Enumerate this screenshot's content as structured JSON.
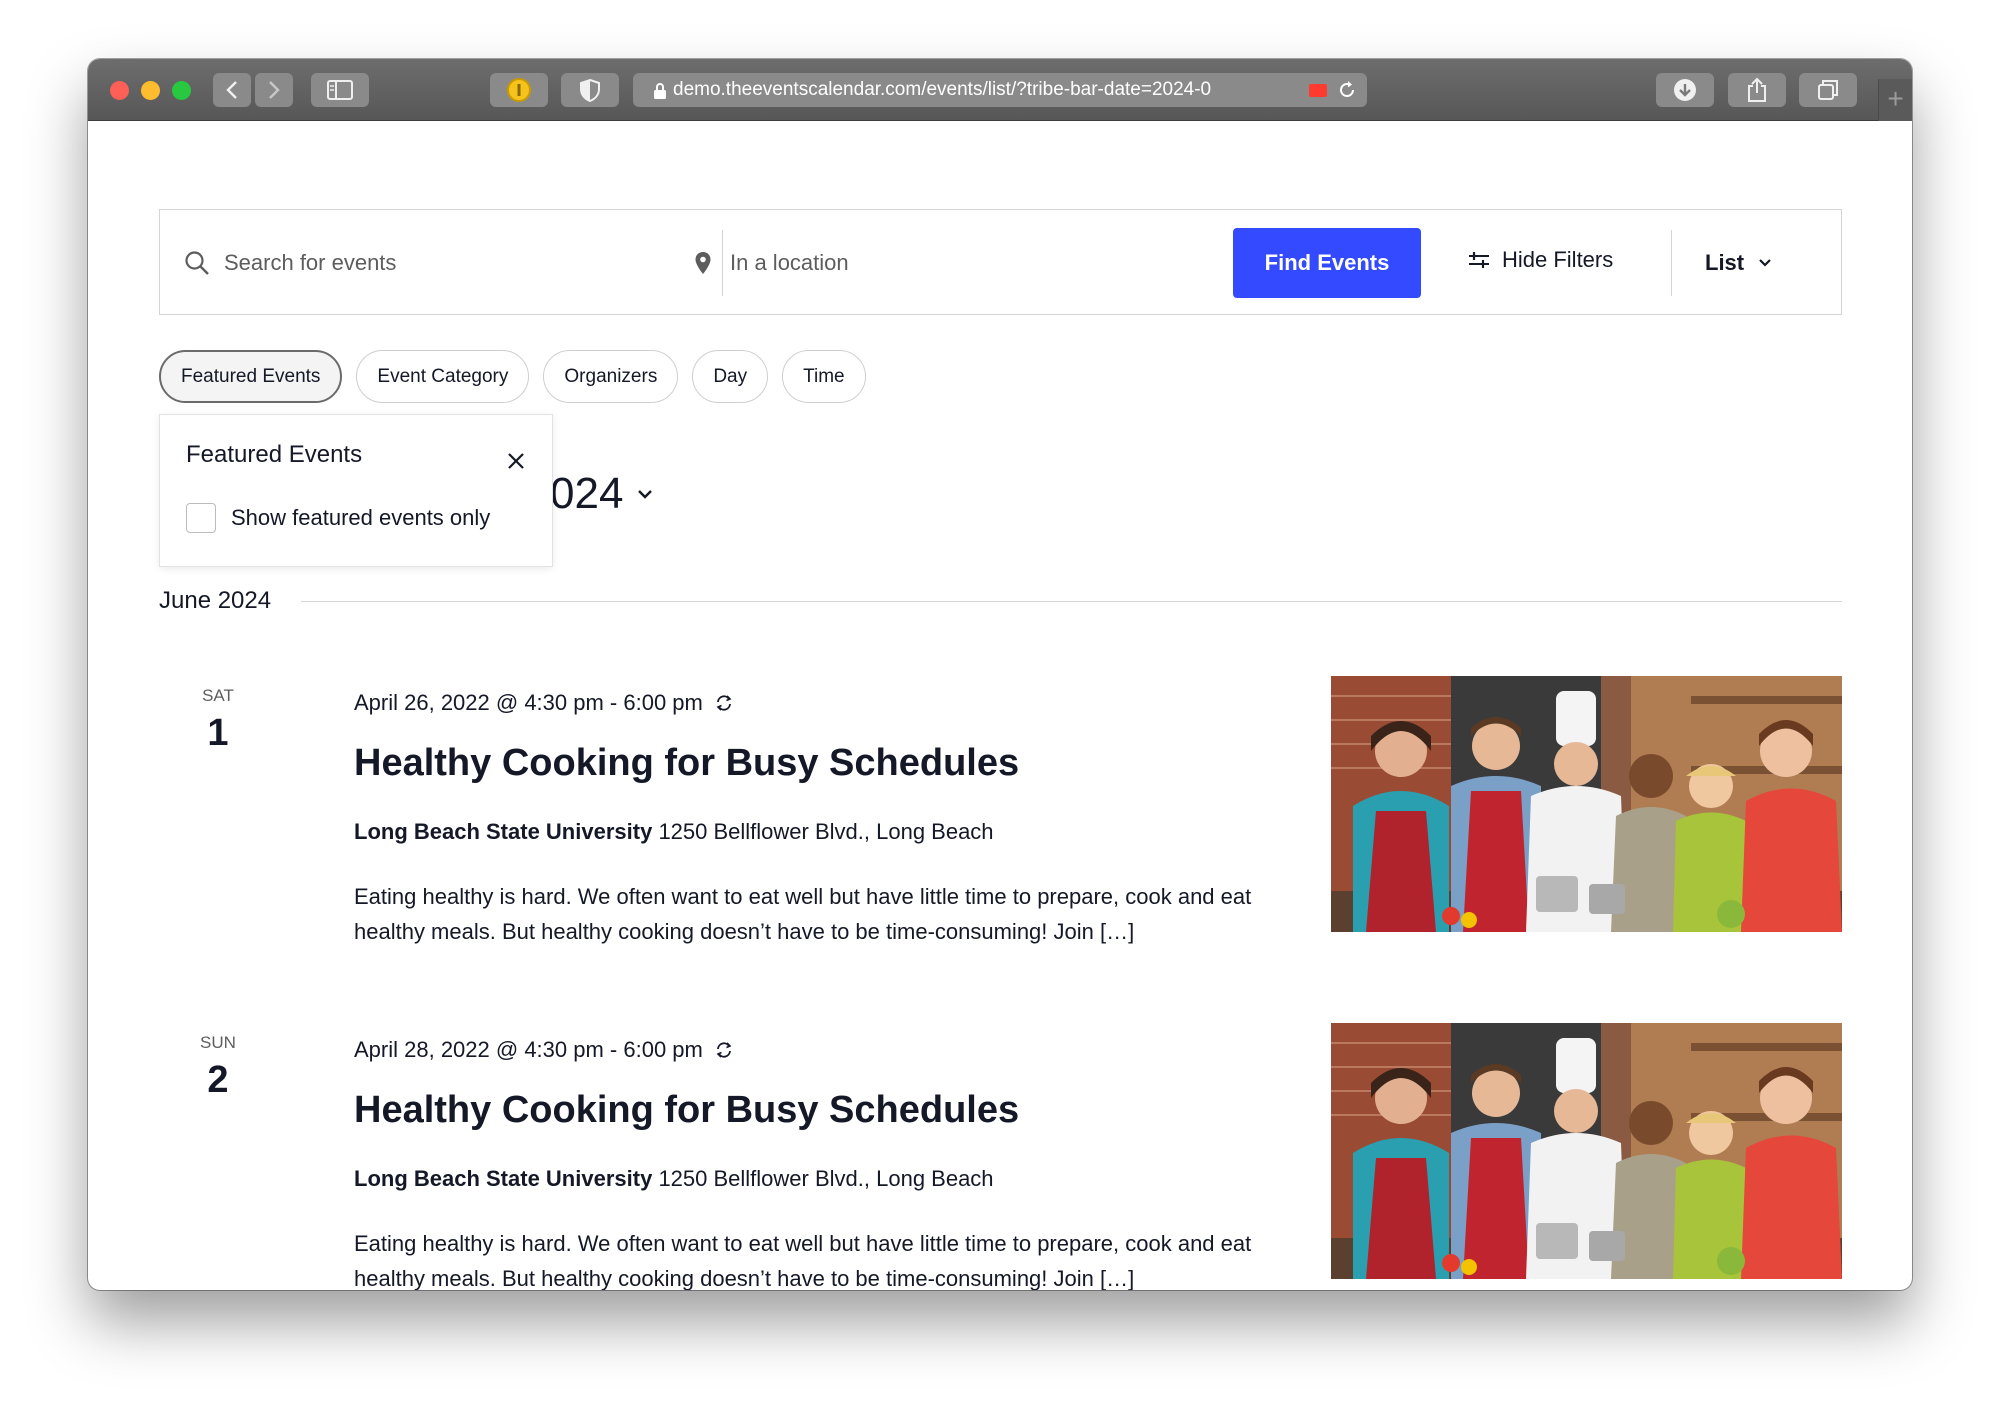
{
  "browser": {
    "url": "demo.theeventscalendar.com/events/list/?tribe-bar-date=2024-0"
  },
  "search": {
    "keyword_placeholder": "Search for events",
    "location_placeholder": "In a location",
    "find_button": "Find Events",
    "hide_filters": "Hide Filters",
    "view_label": "List",
    "accent_color": "#334aff"
  },
  "filters": {
    "pills": [
      "Featured Events",
      "Event Category",
      "Organizers",
      "Day",
      "Time"
    ],
    "dropdown": {
      "title": "Featured Events",
      "checkbox_label": "Show featured events only"
    }
  },
  "date_heading_partial": "024",
  "month_separator": "June 2024",
  "events": [
    {
      "day_of_week": "SAT",
      "day_number": "1",
      "datetime": "April 26, 2022 @ 4:30 pm - 6:00 pm",
      "title": "Healthy Cooking for Busy Schedules",
      "venue_name": "Long Beach State University",
      "venue_address": "1250 Bellflower Blvd., Long Beach",
      "description": "Eating healthy is hard. We often want to eat well but have little time to prepare, cook and eat healthy meals. But healthy cooking doesn’t have to be time-consuming! Join […]"
    },
    {
      "day_of_week": "SUN",
      "day_number": "2",
      "datetime": "April 28, 2022 @ 4:30 pm - 6:00 pm",
      "title": "Healthy Cooking for Busy Schedules",
      "venue_name": "Long Beach State University",
      "venue_address": "1250 Bellflower Blvd., Long Beach",
      "description": "Eating healthy is hard. We often want to eat well but have little time to prepare, cook and eat healthy meals. But healthy cooking doesn’t have to be time-consuming! Join […]"
    }
  ]
}
